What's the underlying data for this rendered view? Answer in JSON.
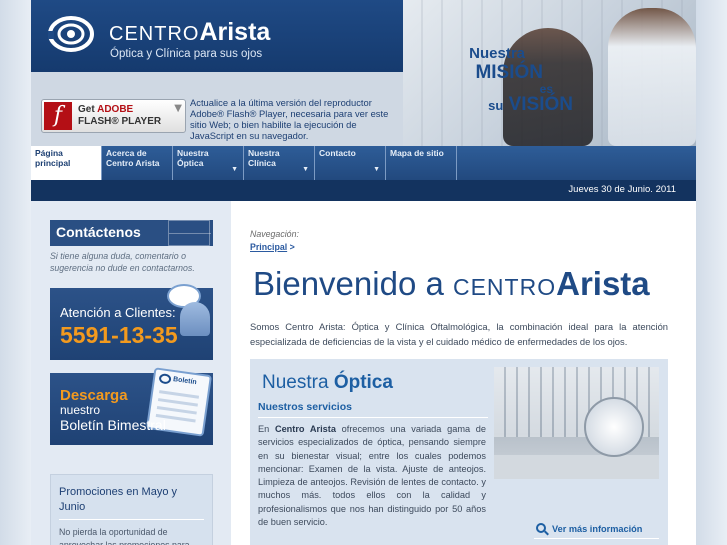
{
  "colors": {
    "brand_blue": "#1f4a85",
    "accent_orange": "#f39a1e",
    "nav_blue": "#2e5d98"
  },
  "header": {
    "brand_prefix": "CENTRO",
    "brand_name": "Arista",
    "tagline": "Óptica y Clínica para sus ojos",
    "mision": {
      "l1": "Nuestra",
      "l2": "MISIÓN",
      "l3": "es",
      "l4_prefix": "su",
      "l4": "VISIÓN"
    }
  },
  "flash": {
    "get": "Get",
    "adobe": "ADOBE",
    "player": "FLASH® PLAYER",
    "note": "Actualice a la última versión del reproductor Adobe® Flash® Player, necesaria para ver este sitio Web; o bien habilite la ejecución de JavaScript en su navegador."
  },
  "nav": {
    "items": [
      {
        "l1": "Página",
        "l2": "principal"
      },
      {
        "l1": "Acerca de",
        "l2": "Centro Arista"
      },
      {
        "l1": "Nuestra",
        "l2": "Óptica"
      },
      {
        "l1": "Nuestra",
        "l2": "Clínica"
      },
      {
        "l1": "Contacto",
        "l2": ""
      },
      {
        "l1": "Mapa de sitio",
        "l2": ""
      }
    ],
    "date": "Jueves 30 de Junio. 2011"
  },
  "sidebar": {
    "contact_title": "Contáctenos",
    "contact_text": "Si tiene alguna duda, comentario o sugerencia no dude en contactarnos.",
    "attention_label": "Atención a Clientes:",
    "attention_phone": "5591-13-35",
    "download_l1": "Descarga",
    "download_l2": "nuestro",
    "download_l3": "Boletín Bimestral",
    "booklet_label": "Boletín",
    "promo_title": "Promociones en Mayo y Junio",
    "promo_text": "No pierda la oportunidad de aprovechar las promociones para"
  },
  "main": {
    "nav_label": "Navegación:",
    "crumb": "Principal",
    "crumb_sep": ">",
    "welcome_1": "Bienvenido a ",
    "welcome_2": "CENTRO",
    "welcome_3": "Arista",
    "intro": "Somos Centro Arista: Óptica y Clínica Oftalmológica, la combinación ideal para la atención especializada de deficiencias de la vista y el cuidado médico de enfermedades de los ojos.",
    "optica": {
      "title_1": "Nuestra ",
      "title_2": "Óptica",
      "subtitle": "Nuestros servicios",
      "body_1": "En ",
      "body_bold": "Centro Arista",
      "body_2": " ofrecemos una variada gama de servicios especializados de óptica, pensando siempre en su bienestar visual; entre los cuales podemos mencionar: Examen de la vista. Ajuste de anteojos. Limpieza de anteojos. Revisión de lentes de contacto. y muchos más. todos ellos con la calidad y profesionalismos que nos han distinguido por 50 años de buen servicio.",
      "more": "Ver más información"
    }
  }
}
